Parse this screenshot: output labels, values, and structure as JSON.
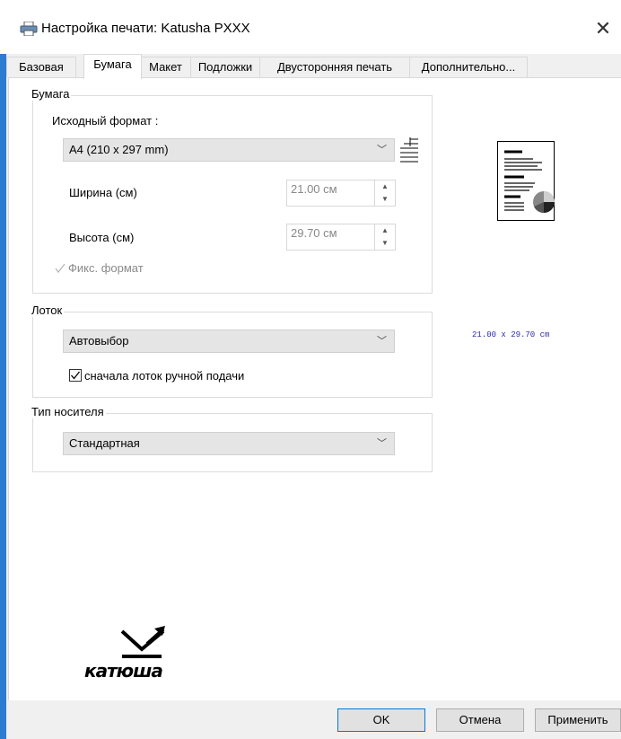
{
  "window": {
    "title": "Настройка печати: Katusha PXXX",
    "close_glyph": "✕"
  },
  "tabs": [
    {
      "label": "Базовая"
    },
    {
      "label": "Бумага"
    },
    {
      "label": "Макет"
    },
    {
      "label": "Подложки"
    },
    {
      "label": "Двусторонняя печать"
    },
    {
      "label": "Дополнительно..."
    }
  ],
  "paper": {
    "group_title": "Бумага",
    "source_format_label": "Исходный формат :",
    "source_format_value": "A4 (210 x 297 mm)",
    "width_label": "Ширина (см)",
    "width_value": "21.00 см",
    "height_label": "Высота (см)",
    "height_value": "29.70 см",
    "fixed_format_label": "Фикс. формат",
    "fixed_format_checked": true
  },
  "tray": {
    "group_title": "Лоток",
    "value": "Автовыбор",
    "manual_first_label": "сначала лоток ручной подачи",
    "manual_first_checked": true
  },
  "media": {
    "group_title": "Тип носителя",
    "value": "Стандартная"
  },
  "preview": {
    "size_text": "21.00 x 29.70 cm"
  },
  "logo": {
    "text": "катюша"
  },
  "buttons": {
    "ok": "OK",
    "cancel": "Отмена",
    "apply": "Применить"
  },
  "colors": {
    "accent": "#2d7cd1",
    "preview_text": "#2a2aa8",
    "default_button_border": "#0078d7"
  }
}
